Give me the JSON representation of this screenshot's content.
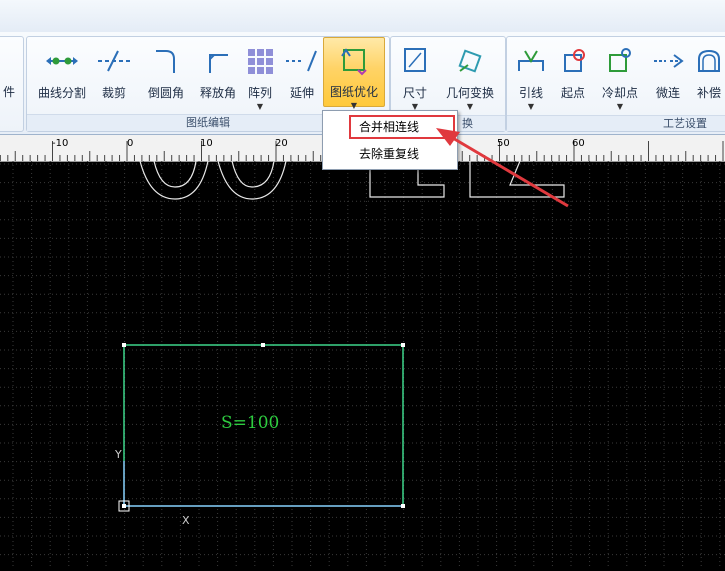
{
  "ribbon": {
    "left_edge_label": "件",
    "groups": [
      {
        "title": "图纸编辑"
      },
      {
        "title": "换"
      },
      {
        "title": "工艺设置"
      }
    ],
    "tools": {
      "curve_split": "曲线分割",
      "trim": "裁剪",
      "fillet": "倒圆角",
      "offset": "释放角",
      "array": "阵列",
      "extend": "延伸",
      "drawing_optimize": "图纸优化",
      "dimension": "尺寸",
      "geometric_transform": "几何变换",
      "lead_line": "引线",
      "start_point": "起点",
      "cooling_point": "冷却点",
      "micro_joint": "微连",
      "compensation": "补偿"
    }
  },
  "dropdown": {
    "items": [
      "合并相连线",
      "去除重复线"
    ]
  },
  "ruler": {
    "labels": [
      "-10",
      "0",
      "10",
      "20",
      "50",
      "60"
    ]
  },
  "canvas": {
    "area_label": "S=100",
    "axis_x": "X",
    "axis_y": "Y"
  },
  "colors": {
    "shape_stroke": "#3ed68a",
    "area_text": "#2ecc40",
    "arrow": "#e0393e",
    "active_tool": "#ffd366"
  }
}
